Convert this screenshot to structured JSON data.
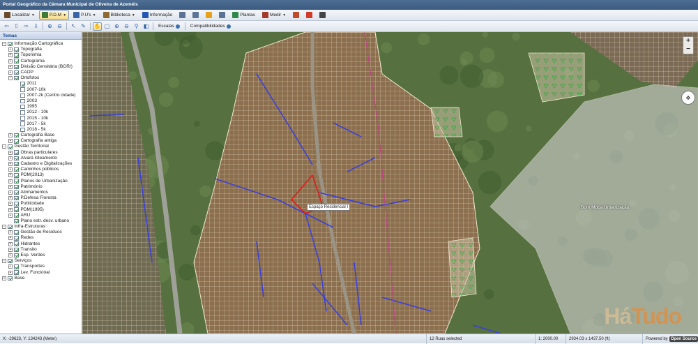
{
  "window": {
    "title": "Portal Geográfico da Câmara Municipal de Oliveira de Azeméis"
  },
  "menubar": {
    "items": [
      {
        "label": "Localizar",
        "icon": "binoculars-icon",
        "color": "#6b4a2c",
        "active": false
      },
      {
        "label": "P.D.M",
        "icon": "map-icon",
        "color": "#3f7a3a",
        "active": true
      },
      {
        "label": "P.U's",
        "icon": "plan-icon",
        "color": "#3a63a8",
        "active": false
      },
      {
        "label": "Biblioteca",
        "icon": "library-icon",
        "color": "#8c6a32",
        "active": false
      },
      {
        "label": "Informação",
        "icon": "info-icon",
        "color": "#2457b3",
        "active": false
      },
      {
        "label": "Plantas",
        "icon": "plant-icon",
        "color": "#2e8a4b",
        "active": false
      },
      {
        "label": "Medir",
        "icon": "ruler-icon",
        "color": "#a33a2a",
        "active": false
      }
    ]
  },
  "toolbar": {
    "escalas_label": "Escalas",
    "compat_label": "Compatibilidades"
  },
  "sidebar": {
    "title": "Temas",
    "tree": [
      {
        "label": "Informação Cartográfica",
        "level": 0,
        "expander": "-",
        "checked": true
      },
      {
        "label": "Topografia",
        "level": 1,
        "expander": "+",
        "checked": true
      },
      {
        "label": "Toponímia",
        "level": 1,
        "expander": "+",
        "checked": true
      },
      {
        "label": "Cartograma",
        "level": 1,
        "expander": "+",
        "checked": true
      },
      {
        "label": "Divisão Censitária (BGRI)",
        "level": 1,
        "expander": "+",
        "checked": true
      },
      {
        "label": "CAOP",
        "level": 1,
        "expander": "+",
        "checked": true
      },
      {
        "label": "Ortofotos",
        "level": 1,
        "expander": "-",
        "checked": true
      },
      {
        "label": "2011",
        "level": 2,
        "expander": "",
        "checked": true
      },
      {
        "label": "2007-10k",
        "level": 2,
        "expander": "",
        "checked": false
      },
      {
        "label": "2007-2k (Centro cidade)",
        "level": 2,
        "expander": "",
        "checked": false
      },
      {
        "label": "2003",
        "level": 2,
        "expander": "",
        "checked": false
      },
      {
        "label": "1995",
        "level": 2,
        "expander": "",
        "checked": false
      },
      {
        "label": "2012 - 10k",
        "level": 2,
        "expander": "",
        "checked": false
      },
      {
        "label": "2015 - 10k",
        "level": 2,
        "expander": "",
        "checked": false
      },
      {
        "label": "2017 - 5k",
        "level": 2,
        "expander": "",
        "checked": false
      },
      {
        "label": "2018 - 5k",
        "level": 2,
        "expander": "",
        "checked": false
      },
      {
        "label": "Cartografia Base",
        "level": 1,
        "expander": "+",
        "checked": true
      },
      {
        "label": "Cartografia antiga",
        "level": 1,
        "expander": "+",
        "checked": true
      },
      {
        "label": "Gestão Territorial",
        "level": 0,
        "expander": "-",
        "checked": true
      },
      {
        "label": "Obras particulares",
        "level": 1,
        "expander": "+",
        "checked": true
      },
      {
        "label": "Alvará loteamento",
        "level": 1,
        "expander": "+",
        "checked": true
      },
      {
        "label": "Cadastro e Digitalizações",
        "level": 1,
        "expander": "+",
        "checked": true
      },
      {
        "label": "Caminhos públicos",
        "level": 1,
        "expander": "+",
        "checked": true
      },
      {
        "label": "PDM(2013)",
        "level": 1,
        "expander": "+",
        "checked": true
      },
      {
        "label": "Planos de Urbanização",
        "level": 1,
        "expander": "+",
        "checked": true
      },
      {
        "label": "Património",
        "level": 1,
        "expander": "+",
        "checked": true
      },
      {
        "label": "Alinhamentos",
        "level": 1,
        "expander": "+",
        "checked": true
      },
      {
        "label": "P.Defesa Floresta",
        "level": 1,
        "expander": "+",
        "checked": true
      },
      {
        "label": "Publicidade",
        "level": 1,
        "expander": "+",
        "checked": true
      },
      {
        "label": "PDM(1995)",
        "level": 1,
        "expander": "+",
        "checked": true
      },
      {
        "label": "ARU",
        "level": 1,
        "expander": "+",
        "checked": true
      },
      {
        "label": "Plano estr. desv. urbano",
        "level": 1,
        "expander": "",
        "checked": true
      },
      {
        "label": "Infra-Estruturas",
        "level": 0,
        "expander": "-",
        "checked": true
      },
      {
        "label": "Gestão de Resíduos",
        "level": 1,
        "expander": "+",
        "checked": true
      },
      {
        "label": "Redes",
        "level": 1,
        "expander": "+",
        "checked": true
      },
      {
        "label": "Hidrantes",
        "level": 1,
        "expander": "+",
        "checked": true
      },
      {
        "label": "Transito",
        "level": 1,
        "expander": "+",
        "checked": true
      },
      {
        "label": "Esp. Verdes",
        "level": 1,
        "expander": "+",
        "checked": true
      },
      {
        "label": "Serviços",
        "level": 0,
        "expander": "-",
        "checked": true
      },
      {
        "label": "Transportes",
        "level": 1,
        "expander": "+",
        "checked": true
      },
      {
        "label": "Lev. Funcional",
        "level": 1,
        "expander": "+",
        "checked": true
      },
      {
        "label": "Base",
        "level": 0,
        "expander": "+",
        "checked": true
      }
    ]
  },
  "map": {
    "popup_label": "Espaço Residencial I",
    "area_label": "Bom Moca Urbanização",
    "watermark_a": "Há",
    "watermark_b": "Tudo",
    "colors": {
      "vegetation": "#4d6a38",
      "urban": "#8a6e4e",
      "parcel_line": "#f4e9d2",
      "street": "#3b3fd9",
      "selection": "#e01818",
      "overlay": "#c9c9c9"
    }
  },
  "status": {
    "coords": "X: -29623, Y: 134243 (Meter)",
    "selection": "12 Ruas selected",
    "scale": "1: 2000.00",
    "extent": "2934.03 x 1437.50 (ft)",
    "powered_by": "Powered by",
    "os_badge": "Open Source"
  }
}
